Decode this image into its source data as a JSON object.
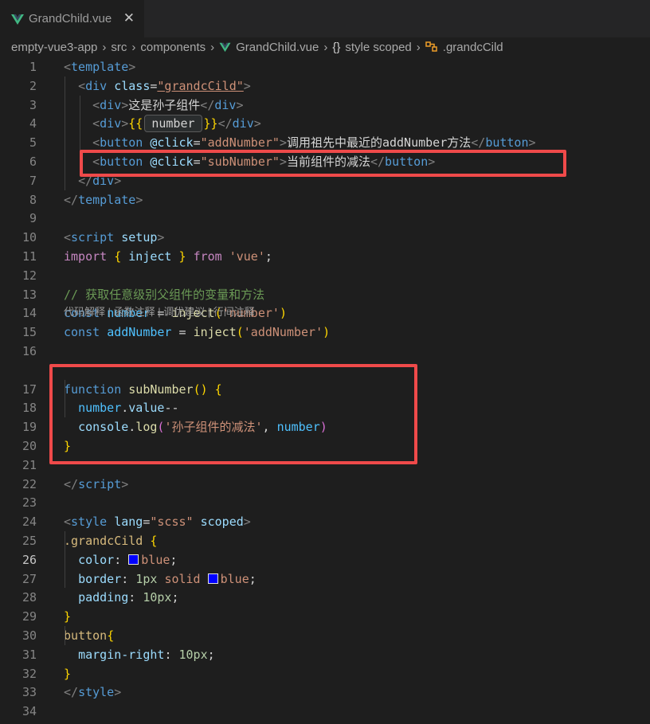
{
  "tab": {
    "label": "GrandChild.vue",
    "close": "✕"
  },
  "breadcrumb": {
    "items": [
      "empty-vue3-app",
      "src",
      "components",
      "GrandChild.vue",
      "style scoped",
      ".grandcCild"
    ],
    "separator": "›"
  },
  "codelens": "代码解释 | 函数注释 | 调优建议 | 行间注释",
  "inlay_hint": "number",
  "active_line": 26,
  "highlight_color": "#ef4a4a",
  "swatch_color": "#0000ff",
  "lines": [
    {
      "n": "1",
      "segs": [
        [
          "<",
          "t-br"
        ],
        [
          "template",
          "t-tag"
        ],
        [
          ">",
          "t-br"
        ]
      ]
    },
    {
      "n": "2",
      "segs": [
        [
          "  ",
          ""
        ],
        [
          "<",
          "t-br"
        ],
        [
          "div",
          "t-tag"
        ],
        [
          " ",
          ""
        ],
        [
          "class",
          "t-attr"
        ],
        [
          "=",
          "t-p"
        ],
        [
          "\"grandcCild\"",
          "t-str"
        ],
        [
          ">",
          "t-br"
        ]
      ]
    },
    {
      "n": "3",
      "segs": [
        [
          "    ",
          ""
        ],
        [
          "<",
          "t-br"
        ],
        [
          "div",
          "t-tag"
        ],
        [
          ">",
          "t-br"
        ],
        [
          "这是孙子组件",
          "t-p"
        ],
        [
          "</",
          "t-br"
        ],
        [
          "div",
          "t-tag"
        ],
        [
          ">",
          "t-br"
        ]
      ]
    },
    {
      "n": "4",
      "segs": [
        [
          "    ",
          ""
        ],
        [
          "<",
          "t-br"
        ],
        [
          "div",
          "t-tag"
        ],
        [
          ">",
          "t-br"
        ],
        [
          "{{",
          "t-gold"
        ],
        [
          "INLAY",
          ""
        ],
        [
          "}}",
          "t-gold"
        ],
        [
          "</",
          "t-br"
        ],
        [
          "div",
          "t-tag"
        ],
        [
          ">",
          "t-br"
        ]
      ]
    },
    {
      "n": "5",
      "segs": [
        [
          "    ",
          ""
        ],
        [
          "<",
          "t-br"
        ],
        [
          "button",
          "t-tag"
        ],
        [
          " ",
          ""
        ],
        [
          "@click",
          "t-attr"
        ],
        [
          "=",
          "t-p"
        ],
        [
          "\"addNumber\"",
          "t-str"
        ],
        [
          ">",
          "t-br"
        ],
        [
          "调用祖先中最近的addNumber方法",
          "t-p"
        ],
        [
          "</",
          "t-br"
        ],
        [
          "button",
          "t-tag"
        ],
        [
          ">",
          "t-br"
        ]
      ]
    },
    {
      "n": "6",
      "segs": [
        [
          "    ",
          ""
        ],
        [
          "<",
          "t-br"
        ],
        [
          "button",
          "t-tag"
        ],
        [
          " ",
          ""
        ],
        [
          "@click",
          "t-attr"
        ],
        [
          "=",
          "t-p"
        ],
        [
          "\"subNumber\"",
          "t-str"
        ],
        [
          ">",
          "t-br"
        ],
        [
          "当前组件的减法",
          "t-p"
        ],
        [
          "</",
          "t-br"
        ],
        [
          "button",
          "t-tag"
        ],
        [
          ">",
          "t-br"
        ]
      ]
    },
    {
      "n": "7",
      "segs": [
        [
          "  ",
          ""
        ],
        [
          "</",
          "t-br"
        ],
        [
          "div",
          "t-tag"
        ],
        [
          ">",
          "t-br"
        ]
      ]
    },
    {
      "n": "8",
      "segs": [
        [
          "</",
          "t-br"
        ],
        [
          "template",
          "t-tag"
        ],
        [
          ">",
          "t-br"
        ]
      ]
    },
    {
      "n": "9",
      "segs": []
    },
    {
      "n": "10",
      "segs": [
        [
          "<",
          "t-br"
        ],
        [
          "script",
          "t-tag"
        ],
        [
          " ",
          ""
        ],
        [
          "setup",
          "t-attr"
        ],
        [
          ">",
          "t-br"
        ]
      ]
    },
    {
      "n": "11",
      "segs": [
        [
          "import",
          "t-ctrl"
        ],
        [
          " ",
          ""
        ],
        [
          "{",
          "t-gold"
        ],
        [
          " ",
          ""
        ],
        [
          "inject",
          "t-var"
        ],
        [
          " ",
          ""
        ],
        [
          "}",
          "t-gold"
        ],
        [
          " ",
          ""
        ],
        [
          "from",
          "t-ctrl"
        ],
        [
          " ",
          ""
        ],
        [
          "'vue'",
          "t-str"
        ],
        [
          ";",
          "t-p"
        ]
      ]
    },
    {
      "n": "12",
      "segs": []
    },
    {
      "n": "13",
      "segs": [
        [
          "// 获取任意级别父组件的变量和方法",
          "t-com"
        ]
      ]
    },
    {
      "n": "14",
      "segs": [
        [
          "const",
          "t-kw"
        ],
        [
          " ",
          ""
        ],
        [
          "number",
          "t-const"
        ],
        [
          " = ",
          "t-p"
        ],
        [
          "inject",
          "t-fn"
        ],
        [
          "(",
          "t-gold"
        ],
        [
          "'number'",
          "t-str"
        ],
        [
          ")",
          "t-gold"
        ]
      ]
    },
    {
      "n": "15",
      "segs": [
        [
          "const",
          "t-kw"
        ],
        [
          " ",
          ""
        ],
        [
          "addNumber",
          "t-const"
        ],
        [
          " = ",
          "t-p"
        ],
        [
          "inject",
          "t-fn"
        ],
        [
          "(",
          "t-gold"
        ],
        [
          "'addNumber'",
          "t-str"
        ],
        [
          ")",
          "t-gold"
        ]
      ]
    },
    {
      "n": "16",
      "segs": []
    },
    {
      "n": "17",
      "segs": [
        [
          "function",
          "t-kw"
        ],
        [
          " ",
          ""
        ],
        [
          "subNumber",
          "t-fn"
        ],
        [
          "()",
          "t-gold"
        ],
        [
          " ",
          ""
        ],
        [
          "{",
          "t-gold"
        ]
      ]
    },
    {
      "n": "18",
      "segs": [
        [
          "  ",
          ""
        ],
        [
          "number",
          "t-const"
        ],
        [
          ".",
          "t-p"
        ],
        [
          "value",
          "t-var"
        ],
        [
          "--",
          "t-p"
        ]
      ]
    },
    {
      "n": "19",
      "segs": [
        [
          "  ",
          ""
        ],
        [
          "console",
          "t-var"
        ],
        [
          ".",
          "t-p"
        ],
        [
          "log",
          "t-fn"
        ],
        [
          "(",
          "t-pur"
        ],
        [
          "'孙子组件的减法'",
          "t-str"
        ],
        [
          ", ",
          "t-p"
        ],
        [
          "number",
          "t-const"
        ],
        [
          ")",
          "t-pur"
        ]
      ]
    },
    {
      "n": "20",
      "segs": [
        [
          "}",
          "t-gold"
        ]
      ]
    },
    {
      "n": "21",
      "segs": []
    },
    {
      "n": "22",
      "segs": [
        [
          "</",
          "t-br"
        ],
        [
          "script",
          "t-tag"
        ],
        [
          ">",
          "t-br"
        ]
      ]
    },
    {
      "n": "23",
      "segs": []
    },
    {
      "n": "24",
      "segs": [
        [
          "<",
          "t-br"
        ],
        [
          "style",
          "t-tag"
        ],
        [
          " ",
          ""
        ],
        [
          "lang",
          "t-attr"
        ],
        [
          "=",
          "t-p"
        ],
        [
          "\"scss\"",
          "t-str"
        ],
        [
          " ",
          ""
        ],
        [
          "scoped",
          "t-attr"
        ],
        [
          ">",
          "t-br"
        ]
      ]
    },
    {
      "n": "25",
      "segs": [
        [
          ".grandcCild",
          "t-sel"
        ],
        [
          " ",
          ""
        ],
        [
          "{",
          "t-gold"
        ]
      ]
    },
    {
      "n": "26",
      "segs": [
        [
          "  ",
          ""
        ],
        [
          "color",
          "t-prop"
        ],
        [
          ": ",
          "t-p"
        ],
        [
          "SWATCH",
          ""
        ],
        [
          "blue",
          "t-val"
        ],
        [
          ";",
          "t-p"
        ]
      ]
    },
    {
      "n": "27",
      "segs": [
        [
          "  ",
          ""
        ],
        [
          "border",
          "t-prop"
        ],
        [
          ": ",
          "t-p"
        ],
        [
          "1px",
          "t-num"
        ],
        [
          " ",
          ""
        ],
        [
          "solid",
          "t-val"
        ],
        [
          " ",
          ""
        ],
        [
          "SWATCH",
          ""
        ],
        [
          "blue",
          "t-val"
        ],
        [
          ";",
          "t-p"
        ]
      ]
    },
    {
      "n": "28",
      "segs": [
        [
          "  ",
          ""
        ],
        [
          "padding",
          "t-prop"
        ],
        [
          ": ",
          "t-p"
        ],
        [
          "10px",
          "t-num"
        ],
        [
          ";",
          "t-p"
        ]
      ]
    },
    {
      "n": "29",
      "segs": [
        [
          "}",
          "t-gold"
        ]
      ]
    },
    {
      "n": "30",
      "segs": [
        [
          "button",
          "t-sel"
        ],
        [
          "{",
          "t-gold"
        ]
      ]
    },
    {
      "n": "31",
      "segs": [
        [
          "  ",
          ""
        ],
        [
          "margin-right",
          "t-prop"
        ],
        [
          ": ",
          "t-p"
        ],
        [
          "10px",
          "t-num"
        ],
        [
          ";",
          "t-p"
        ]
      ]
    },
    {
      "n": "32",
      "segs": [
        [
          "}",
          "t-gold"
        ]
      ]
    },
    {
      "n": "33",
      "segs": [
        [
          "</",
          "t-br"
        ],
        [
          "style",
          "t-tag"
        ],
        [
          ">",
          "t-br"
        ]
      ]
    },
    {
      "n": "34",
      "segs": []
    }
  ]
}
